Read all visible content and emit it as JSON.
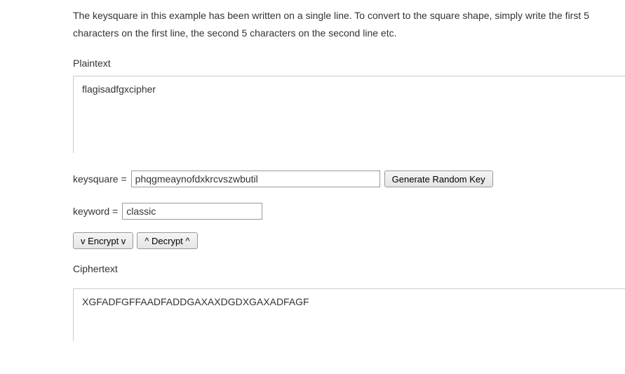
{
  "intro": {
    "line": "The keysquare in this example has been written on a single line. To convert to the square shape, simply write the first 5 characters on the first line, the second 5 characters on the second line etc."
  },
  "plaintext": {
    "label": "Plaintext",
    "value": "flagisadfgxcipher"
  },
  "keysquare": {
    "label": "keysquare = ",
    "value": "phqgmeaynofdxkrcvszwbutil"
  },
  "random_key_button": "Generate Random Key",
  "keyword": {
    "label": "keyword = ",
    "value": "classic"
  },
  "encrypt_button": "v Encrypt v",
  "decrypt_button": "^ Decrypt ^",
  "ciphertext": {
    "label": "Ciphertext",
    "value": "XGFADFGFFAADFADDGAXAXDGDXGAXADFAGF"
  }
}
